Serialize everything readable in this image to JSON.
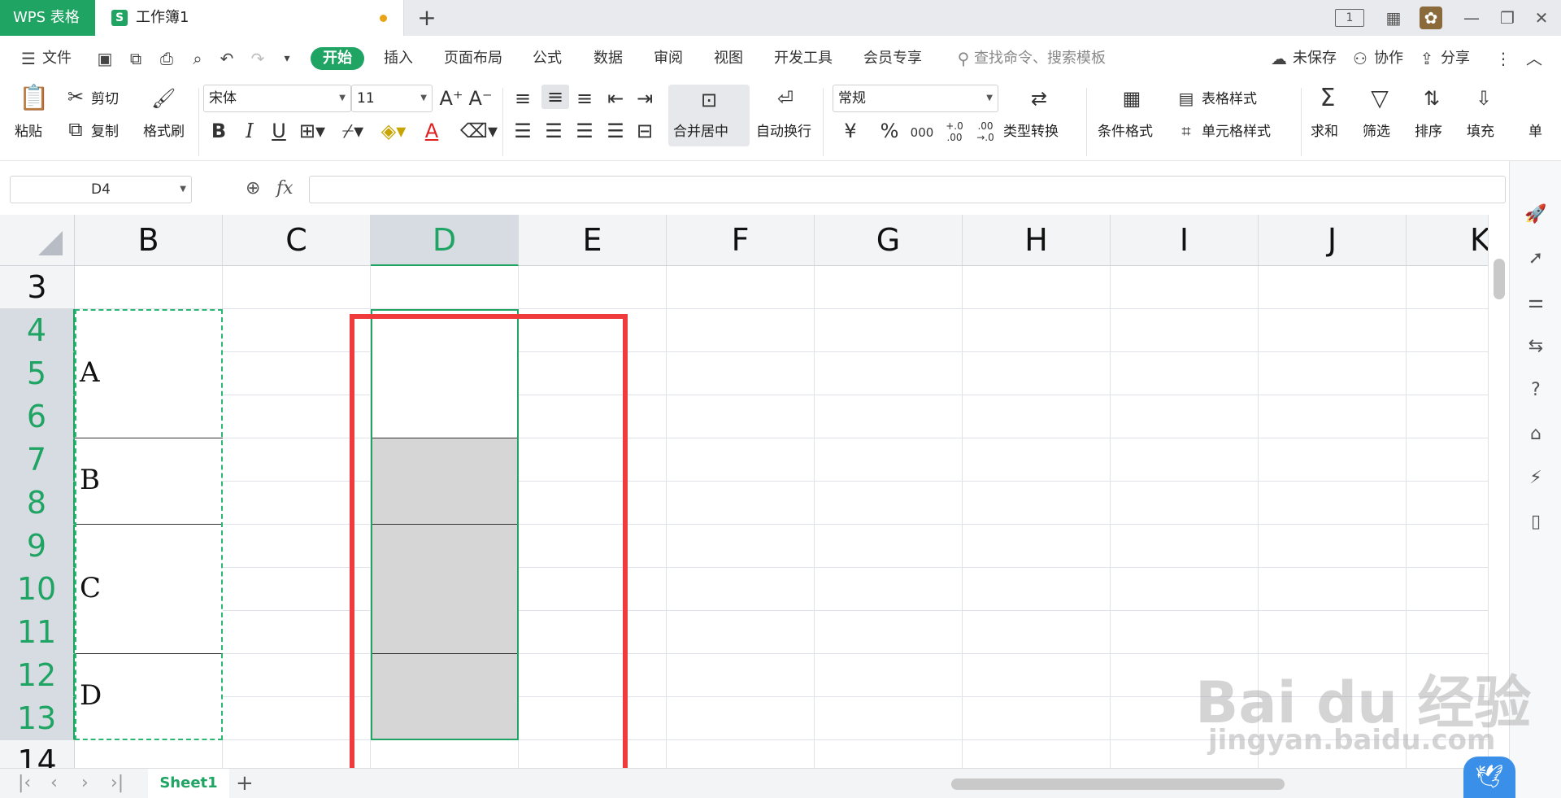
{
  "titlebar": {
    "app_tab": "WPS 表格",
    "doc_icon": "S",
    "doc_tab": "工作簿1",
    "new_tab": "+",
    "page_indicator": "1"
  },
  "menu": {
    "file": "文件",
    "tabs": [
      "开始",
      "插入",
      "页面布局",
      "公式",
      "数据",
      "审阅",
      "视图",
      "开发工具",
      "会员专享"
    ],
    "search": "查找命令、搜索模板",
    "unsaved": "未保存",
    "collab": "协作",
    "share": "分享"
  },
  "ribbon": {
    "paste": "粘贴",
    "cut": "剪切",
    "copy": "复制",
    "format_painter": "格式刷",
    "font_name": "宋体",
    "font_size": "11",
    "merge_center": "合并居中",
    "wrap_text": "自动换行",
    "number_format": "常规",
    "type_convert": "类型转换",
    "cond_format": "条件格式",
    "table_style": "表格样式",
    "cell_style": "单元格样式",
    "sum": "求和",
    "filter": "筛选",
    "sort": "排序",
    "fill": "填充",
    "more": "单",
    "bold": "B",
    "italic": "I",
    "underline": "U",
    "font_color_a": "A",
    "currency": "¥",
    "percent": "%",
    "thousands": "000",
    "dec_inc": "+.0 .00",
    "dec_dec": ".00 →.0"
  },
  "formula_bar": {
    "name_box": "D4",
    "fx": "fx",
    "value": ""
  },
  "grid": {
    "columns": [
      "B",
      "C",
      "D",
      "E",
      "F",
      "G",
      "H",
      "I",
      "J",
      "K"
    ],
    "selected_column": "D",
    "rows": [
      "3",
      "4",
      "5",
      "6",
      "7",
      "8",
      "9",
      "10",
      "11",
      "12",
      "13",
      "14"
    ],
    "selected_rows": [
      "4",
      "5",
      "6",
      "7",
      "8",
      "9",
      "10",
      "11",
      "12",
      "13"
    ],
    "b_labels": [
      "A",
      "B",
      "C",
      "D"
    ]
  },
  "sheets": {
    "tabs": [
      "Sheet1"
    ],
    "add": "+"
  },
  "watermark": {
    "brand": "Bai du 经验",
    "url": "jingyan.baidu.com"
  },
  "colors": {
    "accent": "#1fa463",
    "red_box": "#ef3b3b",
    "gray_fill": "#d6d6d6"
  }
}
